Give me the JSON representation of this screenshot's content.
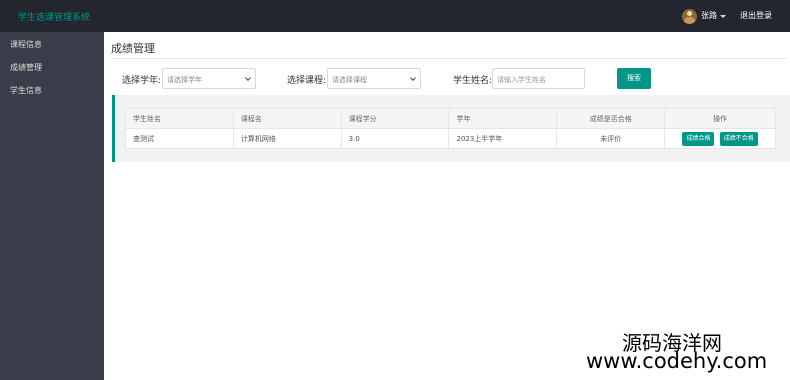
{
  "topbar": {
    "brand": "学生选课管理系统",
    "user_name": "张路",
    "logout_label": "退出登录",
    "bg_color": "#23262e",
    "accent": "#009688"
  },
  "sidebar": {
    "items": [
      {
        "label": "课程信息"
      },
      {
        "label": "成绩管理"
      },
      {
        "label": "学生信息"
      }
    ]
  },
  "main": {
    "title": "成绩管理",
    "filters": {
      "year_label": "选择学年:",
      "year_placeholder": "请选择学年",
      "course_label": "选择课程:",
      "course_placeholder": "请选择课程",
      "student_label": "学生姓名:",
      "student_placeholder": "请输入学生姓名",
      "search_label": "搜索"
    },
    "table": {
      "headers": [
        "学生姓名",
        "课程名",
        "课程学分",
        "学年",
        "成绩是否合格",
        "操作"
      ],
      "rows": [
        {
          "student": "查测试",
          "course": "计算机网络",
          "credit": "3.0",
          "year": "2023上半学年",
          "status": "未评价",
          "pass_label": "成绩合格",
          "fail_label": "成绩不合格"
        }
      ]
    }
  },
  "watermark": {
    "line1": "源码海洋网",
    "line2": "www.codehy.com"
  }
}
